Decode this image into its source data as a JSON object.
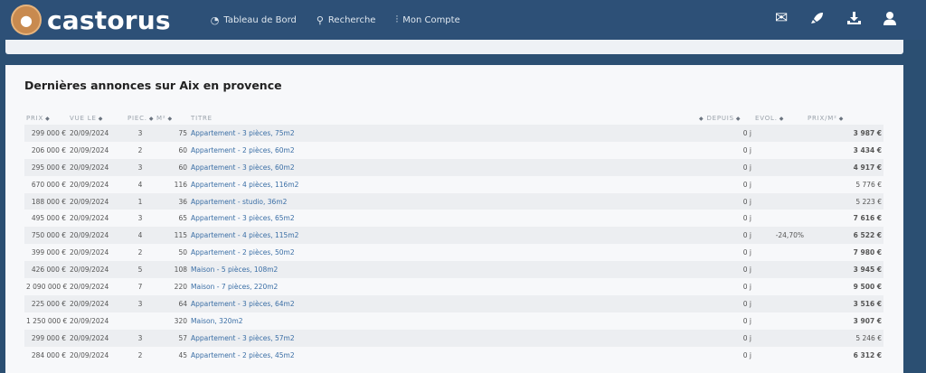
{
  "app": {
    "logo_text": "castorus",
    "logo_icon": "beaver-logo-icon"
  },
  "nav": {
    "links": [
      {
        "label": "Tableau de Bord",
        "icon": "dashboard-icon"
      },
      {
        "label": "Recherche",
        "icon": "search-icon"
      },
      {
        "label": "Mon Compte",
        "icon": "sliders-icon"
      }
    ],
    "right_icons": [
      "mail-icon",
      "rocket-icon",
      "download-icon",
      "user-icon"
    ]
  },
  "panel": {
    "title": "Dernières annonces sur Aix en provence"
  },
  "table": {
    "headers": {
      "prix": "PRIX",
      "vue_le": "VUE LE",
      "pieces": "PIEC.",
      "m2": "M²",
      "titre": "TITRE",
      "depuis": "DEPUIS",
      "evol": "EVOL.",
      "prix_m2": "PRIX/M²"
    },
    "rows": [
      {
        "prix": "299 000 €",
        "vue_le": "20/09/2024",
        "pieces": "3",
        "m2": "75",
        "titre": "Appartement - 3 pièces, 75m2",
        "depuis": "0 j",
        "evol": "",
        "prix_m2": "3 987 €",
        "prix_m2_status": "good"
      },
      {
        "prix": "206 000 €",
        "vue_le": "20/09/2024",
        "pieces": "2",
        "m2": "60",
        "titre": "Appartement - 2 pièces, 60m2",
        "depuis": "0 j",
        "evol": "",
        "prix_m2": "3 434 €",
        "prix_m2_status": "good"
      },
      {
        "prix": "295 000 €",
        "vue_le": "20/09/2024",
        "pieces": "3",
        "m2": "60",
        "titre": "Appartement - 3 pièces, 60m2",
        "depuis": "0 j",
        "evol": "",
        "prix_m2": "4 917 €",
        "prix_m2_status": "good"
      },
      {
        "prix": "670 000 €",
        "vue_le": "20/09/2024",
        "pieces": "4",
        "m2": "116",
        "titre": "Appartement - 4 pièces, 116m2",
        "depuis": "0 j",
        "evol": "",
        "prix_m2": "5 776 €",
        "prix_m2_status": "neutral"
      },
      {
        "prix": "188 000 €",
        "vue_le": "20/09/2024",
        "pieces": "1",
        "m2": "36",
        "titre": "Appartement - studio, 36m2",
        "depuis": "0 j",
        "evol": "",
        "prix_m2": "5 223 €",
        "prix_m2_status": "neutral"
      },
      {
        "prix": "495 000 €",
        "vue_le": "20/09/2024",
        "pieces": "3",
        "m2": "65",
        "titre": "Appartement - 3 pièces, 65m2",
        "depuis": "0 j",
        "evol": "",
        "prix_m2": "7 616 €",
        "prix_m2_status": "bad"
      },
      {
        "prix": "750 000 €",
        "vue_le": "20/09/2024",
        "pieces": "4",
        "m2": "115",
        "titre": "Appartement - 4 pièces, 115m2",
        "depuis": "0 j",
        "evol": "-24,70%",
        "prix_m2": "6 522 €",
        "prix_m2_status": "bad",
        "prix_status": "good"
      },
      {
        "prix": "399 000 €",
        "vue_le": "20/09/2024",
        "pieces": "2",
        "m2": "50",
        "titre": "Appartement - 2 pièces, 50m2",
        "depuis": "0 j",
        "evol": "",
        "prix_m2": "7 980 €",
        "prix_m2_status": "bad"
      },
      {
        "prix": "426 000 €",
        "vue_le": "20/09/2024",
        "pieces": "5",
        "m2": "108",
        "titre": "Maison - 5 pièces, 108m2",
        "depuis": "0 j",
        "evol": "",
        "prix_m2": "3 945 €",
        "prix_m2_status": "good"
      },
      {
        "prix": "2 090 000 €",
        "vue_le": "20/09/2024",
        "pieces": "7",
        "m2": "220",
        "titre": "Maison - 7 pièces, 220m2",
        "depuis": "0 j",
        "evol": "",
        "prix_m2": "9 500 €",
        "prix_m2_status": "bad"
      },
      {
        "prix": "225 000 €",
        "vue_le": "20/09/2024",
        "pieces": "3",
        "m2": "64",
        "titre": "Appartement - 3 pièces, 64m2",
        "depuis": "0 j",
        "evol": "",
        "prix_m2": "3 516 €",
        "prix_m2_status": "good"
      },
      {
        "prix": "1 250 000 €",
        "vue_le": "20/09/2024",
        "pieces": "",
        "m2": "320",
        "titre": "Maison, 320m2",
        "depuis": "0 j",
        "evol": "",
        "prix_m2": "3 907 €",
        "prix_m2_status": "good"
      },
      {
        "prix": "299 000 €",
        "vue_le": "20/09/2024",
        "pieces": "3",
        "m2": "57",
        "titre": "Appartement - 3 pièces, 57m2",
        "depuis": "0 j",
        "evol": "",
        "prix_m2": "5 246 €",
        "prix_m2_status": "neutral"
      },
      {
        "prix": "284 000 €",
        "vue_le": "20/09/2024",
        "pieces": "2",
        "m2": "45",
        "titre": "Appartement - 2 pièces, 45m2",
        "depuis": "0 j",
        "evol": "",
        "prix_m2": "6 312 €",
        "prix_m2_status": "bad"
      }
    ]
  },
  "colors": {
    "navbar": "#2d5077",
    "link": "#3a6ea5",
    "good": "#2f8a25",
    "bad": "#d3312b"
  }
}
